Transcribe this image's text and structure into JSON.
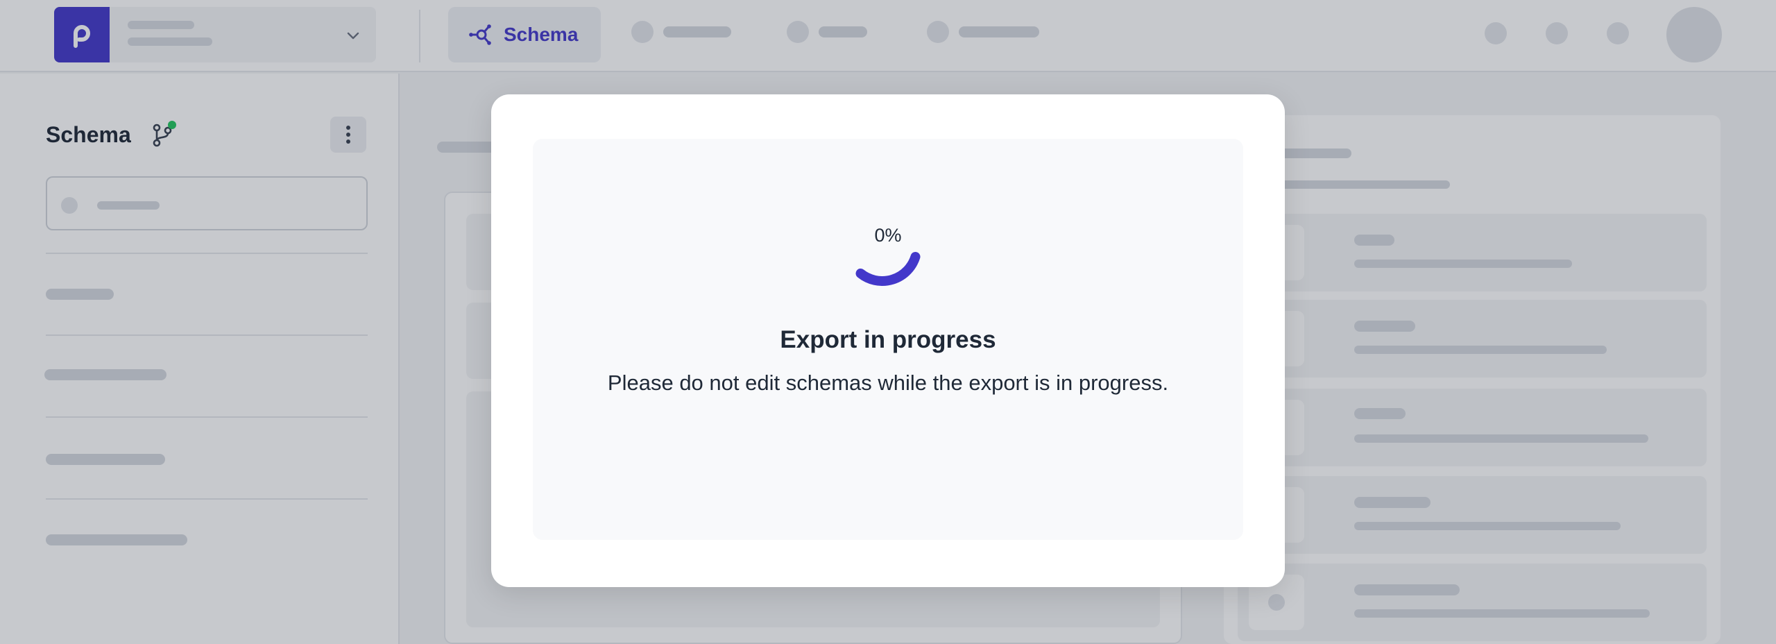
{
  "header": {
    "active_tab_label": "Schema",
    "icons": {
      "project_logo": "p-logo",
      "project_switch": "chevron-down-icon",
      "schema_tab": "schema-graph-icon"
    }
  },
  "sidebar": {
    "title": "Schema",
    "branch_status_color": "#22c55e",
    "icons": {
      "branch": "git-branch-icon",
      "menu": "more-vertical-icon"
    }
  },
  "modal": {
    "progress_label": "0%",
    "progress_value": 0,
    "title": "Export in progress",
    "message": "Please do not edit schemas while the export is in progress."
  },
  "colors": {
    "accent": "#4338ca",
    "overlay": "rgba(31,41,55,0.25)",
    "modal_bg": "#ffffff",
    "modal_inner_bg": "#f8f9fb"
  }
}
